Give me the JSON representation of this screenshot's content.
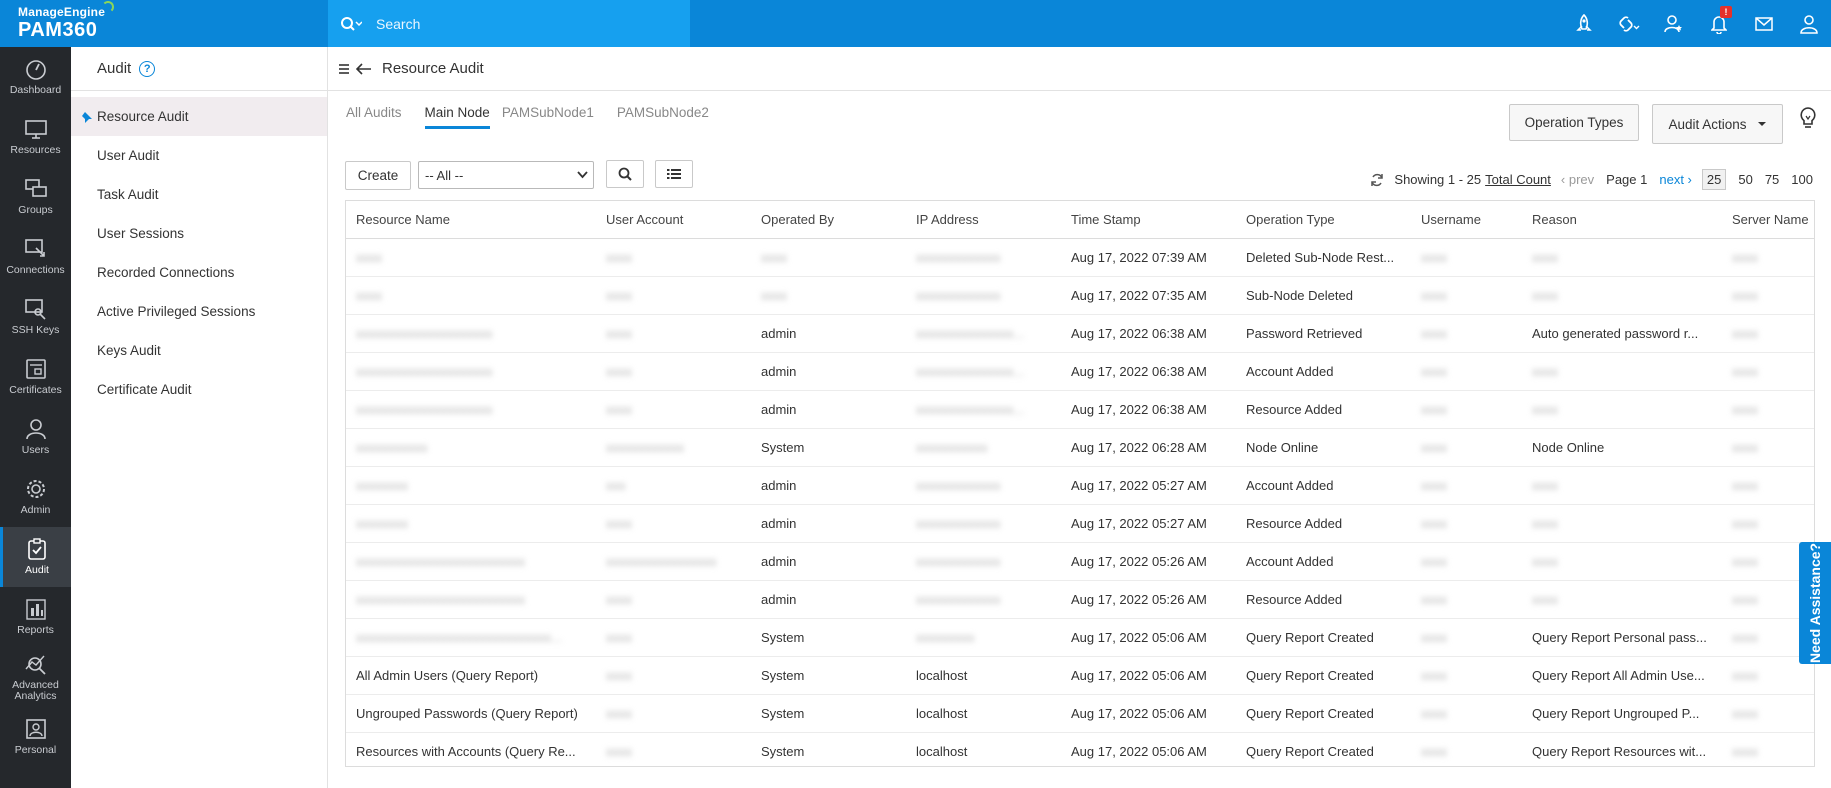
{
  "brand": {
    "vendor": "ManageEngine",
    "product": "PAM360"
  },
  "search": {
    "placeholder": "Search"
  },
  "notifications": {
    "badge": "!"
  },
  "rail": [
    {
      "label": "Dashboard",
      "icon": "dashboard-icon"
    },
    {
      "label": "Resources",
      "icon": "monitor-icon"
    },
    {
      "label": "Groups",
      "icon": "groups-icon"
    },
    {
      "label": "Connections",
      "icon": "connections-icon"
    },
    {
      "label": "SSH Keys",
      "icon": "ssh-key-icon"
    },
    {
      "label": "Certificates",
      "icon": "certificate-icon"
    },
    {
      "label": "Users",
      "icon": "user-icon"
    },
    {
      "label": "Admin",
      "icon": "gear-icon"
    },
    {
      "label": "Audit",
      "icon": "clipboard-check-icon"
    },
    {
      "label": "Reports",
      "icon": "bar-chart-icon"
    },
    {
      "label": "Advanced Analytics",
      "icon": "analytics-icon"
    },
    {
      "label": "Personal",
      "icon": "personal-icon"
    }
  ],
  "submenu": {
    "title": "Audit",
    "help": "?",
    "items": [
      "Resource Audit",
      "User Audit",
      "Task Audit",
      "User Sessions",
      "Recorded Connections",
      "Active Privileged Sessions",
      "Keys Audit",
      "Certificate Audit"
    ]
  },
  "main": {
    "title": "Resource Audit",
    "tabs": [
      "All Audits",
      "Main Node",
      "PAMSubNode1",
      "PAMSubNode2"
    ],
    "operation_types": "Operation Types",
    "audit_actions": "Audit Actions",
    "create": "Create",
    "filter_selected": "-- All --"
  },
  "pager": {
    "showing": "Showing 1 - 25",
    "total": "Total Count",
    "prev": "prev",
    "page": "Page 1",
    "next": "next",
    "sizes": [
      "25",
      "50",
      "75",
      "100"
    ]
  },
  "table": {
    "headers": [
      "Resource Name",
      "User Account",
      "Operated By",
      "IP Address",
      "Time Stamp",
      "Operation Type",
      "Username",
      "Reason",
      "Server Name"
    ],
    "rows": [
      [
        "xxxx",
        "xxxx",
        "xxxx",
        "xxxxxxxxxxxxx",
        "Aug 17, 2022 07:39 AM",
        "Deleted Sub-Node Rest...",
        "xxxx",
        "xxxx",
        "xxxx"
      ],
      [
        "xxxx",
        "xxxx",
        "xxxx",
        "xxxxxxxxxxxxx",
        "Aug 17, 2022 07:35 AM",
        "Sub-Node Deleted",
        "xxxx",
        "xxxx",
        "xxxx"
      ],
      [
        "xxxxxxxxxxxxxxxxxxxxx",
        "xxxx",
        "admin",
        "xxxxxxxxxxxxxxx...",
        "Aug 17, 2022 06:38 AM",
        "Password Retrieved",
        "xxxx",
        "Auto generated password r...",
        "xxxx"
      ],
      [
        "xxxxxxxxxxxxxxxxxxxxx",
        "xxxx",
        "admin",
        "xxxxxxxxxxxxxxx...",
        "Aug 17, 2022 06:38 AM",
        "Account Added",
        "xxxx",
        "xxxx",
        "xxxx"
      ],
      [
        "xxxxxxxxxxxxxxxxxxxxx",
        "xxxx",
        "admin",
        "xxxxxxxxxxxxxxx...",
        "Aug 17, 2022 06:38 AM",
        "Resource Added",
        "xxxx",
        "xxxx",
        "xxxx"
      ],
      [
        "xxxxxxxxxxx",
        "xxxxxxxxxxxx",
        "System",
        "xxxxxxxxxxx",
        "Aug 17, 2022 06:28 AM",
        "Node Online",
        "xxxx",
        "Node Online",
        "xxxx"
      ],
      [
        "xxxxxxxx",
        "xxx",
        "admin",
        "xxxxxxxxxxxxx",
        "Aug 17, 2022 05:27 AM",
        "Account Added",
        "xxxx",
        "xxxx",
        "xxxx"
      ],
      [
        "xxxxxxxx",
        "xxxx",
        "admin",
        "xxxxxxxxxxxxx",
        "Aug 17, 2022 05:27 AM",
        "Resource Added",
        "xxxx",
        "xxxx",
        "xxxx"
      ],
      [
        "xxxxxxxxxxxxxxxxxxxxxxxxxx",
        "xxxxxxxxxxxxxxxxx",
        "admin",
        "xxxxxxxxxxxxx",
        "Aug 17, 2022 05:26 AM",
        "Account Added",
        "xxxx",
        "xxxx",
        "xxxx"
      ],
      [
        "xxxxxxxxxxxxxxxxxxxxxxxxxx",
        "xxxx",
        "admin",
        "xxxxxxxxxxxxx",
        "Aug 17, 2022 05:26 AM",
        "Resource Added",
        "xxxx",
        "xxxx",
        "xxxx"
      ],
      [
        "xxxxxxxxxxxxxxxxxxxxxxxxxxxxxx...",
        "xxxx",
        "System",
        "xxxxxxxxx",
        "Aug 17, 2022 05:06 AM",
        "Query Report Created",
        "xxxx",
        "Query Report Personal pass...",
        "xxxx"
      ],
      [
        "All Admin Users (Query Report)",
        "xxxx",
        "System",
        "localhost",
        "Aug 17, 2022 05:06 AM",
        "Query Report Created",
        "xxxx",
        "Query Report All Admin Use...",
        "xxxx"
      ],
      [
        "Ungrouped Passwords (Query Report)",
        "xxxx",
        "System",
        "localhost",
        "Aug 17, 2022 05:06 AM",
        "Query Report Created",
        "xxxx",
        "Query Report Ungrouped P...",
        "xxxx"
      ],
      [
        "Resources with Accounts (Query Re...",
        "xxxx",
        "System",
        "localhost",
        "Aug 17, 2022 05:06 AM",
        "Query Report Created",
        "xxxx",
        "Query Report Resources wit...",
        "xxxx"
      ]
    ],
    "blurred": [
      [
        true,
        true,
        true,
        true,
        false,
        false,
        true,
        true,
        true
      ],
      [
        true,
        true,
        true,
        true,
        false,
        false,
        true,
        true,
        true
      ],
      [
        true,
        true,
        false,
        true,
        false,
        false,
        true,
        false,
        true
      ],
      [
        true,
        true,
        false,
        true,
        false,
        false,
        true,
        true,
        true
      ],
      [
        true,
        true,
        false,
        true,
        false,
        false,
        true,
        true,
        true
      ],
      [
        true,
        true,
        false,
        true,
        false,
        false,
        true,
        false,
        true
      ],
      [
        true,
        true,
        false,
        true,
        false,
        false,
        true,
        true,
        true
      ],
      [
        true,
        true,
        false,
        true,
        false,
        false,
        true,
        true,
        true
      ],
      [
        true,
        true,
        false,
        true,
        false,
        false,
        true,
        true,
        true
      ],
      [
        true,
        true,
        false,
        true,
        false,
        false,
        true,
        true,
        true
      ],
      [
        true,
        true,
        false,
        true,
        false,
        false,
        true,
        false,
        true
      ],
      [
        false,
        true,
        false,
        false,
        false,
        false,
        true,
        false,
        true
      ],
      [
        false,
        true,
        false,
        false,
        false,
        false,
        true,
        false,
        true
      ],
      [
        false,
        true,
        false,
        false,
        false,
        false,
        true,
        false,
        true
      ]
    ]
  },
  "help_tab": "Need Assistance?",
  "colors": {
    "accent": "#0a86d8",
    "rail": "#25282c",
    "search": "#16a0ef"
  }
}
